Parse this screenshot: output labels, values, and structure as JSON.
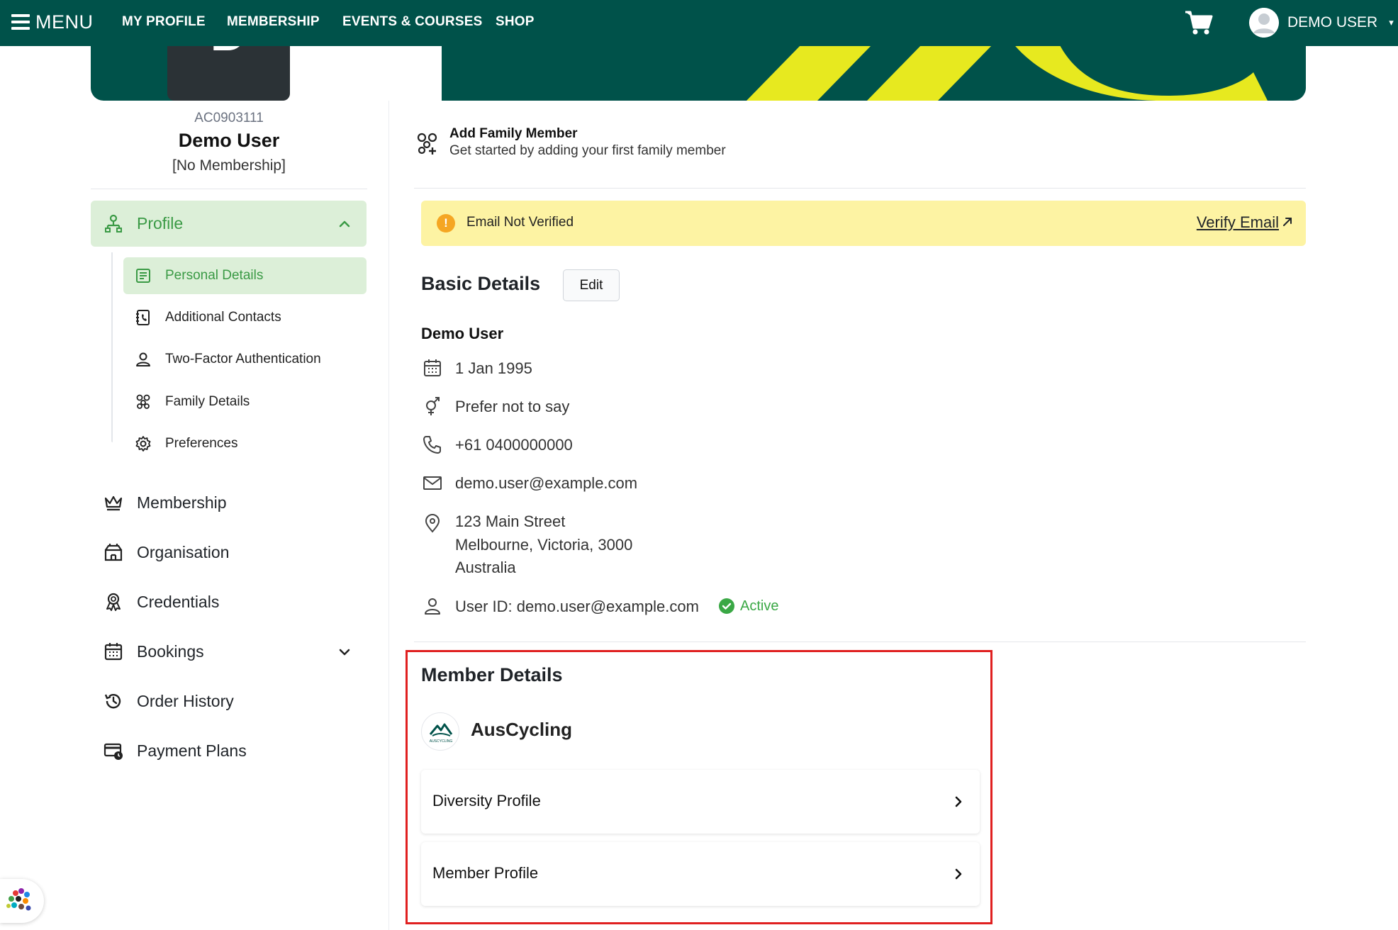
{
  "nav": {
    "menu_label": "MENU",
    "links": [
      "MY PROFILE",
      "MEMBERSHIP",
      "EVENTS & COURSES",
      "SHOP"
    ],
    "user_name": "DEMO USER",
    "colors": {
      "header": "#00524a",
      "banner_accent": "#e7e91f"
    }
  },
  "profile": {
    "photo_initial": "D",
    "member_id": "AC0903111",
    "name": "Demo User",
    "membership_status": "[No Membership]"
  },
  "sidebar": {
    "profile_label": "Profile",
    "sub_items": [
      {
        "label": "Personal Details",
        "icon": "document-icon"
      },
      {
        "label": "Additional Contacts",
        "icon": "contact-book-icon"
      },
      {
        "label": "Two-Factor Authentication",
        "icon": "person-icon"
      },
      {
        "label": "Family Details",
        "icon": "family-icon"
      },
      {
        "label": "Preferences",
        "icon": "gear-icon"
      }
    ],
    "items": [
      {
        "label": "Membership",
        "icon": "crown-icon"
      },
      {
        "label": "Organisation",
        "icon": "building-icon"
      },
      {
        "label": "Credentials",
        "icon": "award-icon"
      },
      {
        "label": "Bookings",
        "icon": "calendar-icon"
      },
      {
        "label": "Order History",
        "icon": "history-icon"
      },
      {
        "label": "Payment Plans",
        "icon": "card-clock-icon"
      }
    ],
    "active_color": "#3a9a45"
  },
  "family": {
    "title": "Add Family Member",
    "subtitle": "Get started by adding your first family member"
  },
  "alert": {
    "message": "Email Not Verified",
    "action": "Verify Email"
  },
  "basic": {
    "title": "Basic Details",
    "edit_label": "Edit",
    "name": "Demo User",
    "dob": "1 Jan 1995",
    "gender": "Prefer not to say",
    "phone": "+61 0400000000",
    "email": "demo.user@example.com",
    "address": [
      "123 Main Street",
      "Melbourne, Victoria, 3000",
      "Australia"
    ],
    "user_id": "User ID: demo.user@example.com",
    "status": "Active"
  },
  "member_details": {
    "title": "Member Details",
    "organisation": "AusCycling",
    "logo_text": "AUSCYCLING",
    "cards": [
      "Diversity Profile",
      "Member Profile"
    ]
  }
}
